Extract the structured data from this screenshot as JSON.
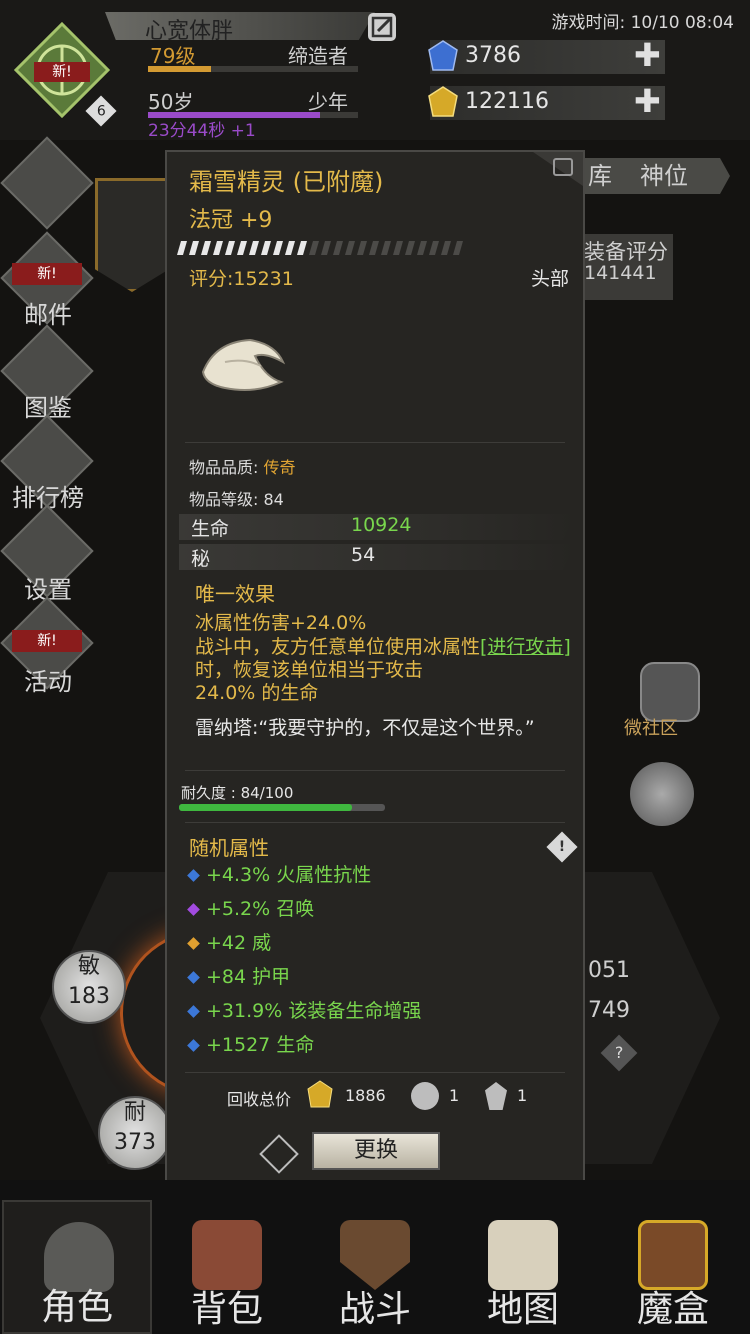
{
  "header": {
    "player_name": "心宽体胖",
    "level": "79级",
    "job": "缔造者",
    "age": "50岁",
    "life_stage": "少年",
    "timer": "23分44秒 +1",
    "game_time": "游戏时间: 10/10 08:04",
    "emblem_badge": "新!",
    "emblem_count": "6",
    "gems": "3786",
    "gold": "122116"
  },
  "left_nav": [
    {
      "label": "邮件",
      "badge": "新!"
    },
    {
      "label": "图鉴"
    },
    {
      "label": "排行榜"
    },
    {
      "label": "设置"
    },
    {
      "label": "活动",
      "badge": "新!"
    }
  ],
  "right_tabs": [
    "库",
    "神位"
  ],
  "right_panel": {
    "score_label": "装备评分",
    "score_value": "141441",
    "community_label": "微社区",
    "stat_a": "051",
    "stat_b": "749"
  },
  "stat_circles": [
    {
      "label": "敏",
      "value": "183"
    },
    {
      "label": "耐",
      "value": "373"
    }
  ],
  "item": {
    "name": "霜雪精灵 (已附魔)",
    "type_line": "法冠 +9",
    "score": "评分:15231",
    "slot": "头部",
    "quality_label": "物品品质: ",
    "quality_value": "传奇",
    "level_label": "物品等级: 84",
    "stats": [
      {
        "name": "生命",
        "value": "10924",
        "color": "#79d64d"
      },
      {
        "name": "秘",
        "value": "54",
        "color": "#e6e6e6"
      }
    ],
    "unique_title": "唯一效果",
    "unique_line1": "冰属性伤害+24.0%",
    "unique_line2a": "战斗中，友方任意单位使用冰属性",
    "unique_link": "[进行攻击]",
    "unique_line2b": "时，恢复该单位相当于攻击",
    "unique_line3": "24.0% 的生命",
    "quote": "雷纳塔:“我要守护的，不仅是这个世界。”",
    "durability_label": "耐久度 : 84/100",
    "durability_fraction": 0.84,
    "random_title": "随机属性",
    "random_attrs": [
      {
        "text": "+4.3% 火属性抗性",
        "gem_color": "#3c78d8"
      },
      {
        "text": "+5.2% 召唤",
        "gem_color": "#a24be0"
      },
      {
        "text": "+42 威",
        "gem_color": "#e0a030"
      },
      {
        "text": "+84 护甲",
        "gem_color": "#3c78d8"
      },
      {
        "text": "+31.9% 该装备生命增强",
        "gem_color": "#3c78d8"
      },
      {
        "text": "+1527 生命",
        "gem_color": "#3c78d8"
      }
    ],
    "recycle_label": "回收总价",
    "recycle_gold": "1886",
    "recycle_mat1": "1",
    "recycle_mat2": "1",
    "swap_button": "更换"
  },
  "bottom_tabs": [
    "角色",
    "背包",
    "战斗",
    "地图",
    "魔盒"
  ]
}
